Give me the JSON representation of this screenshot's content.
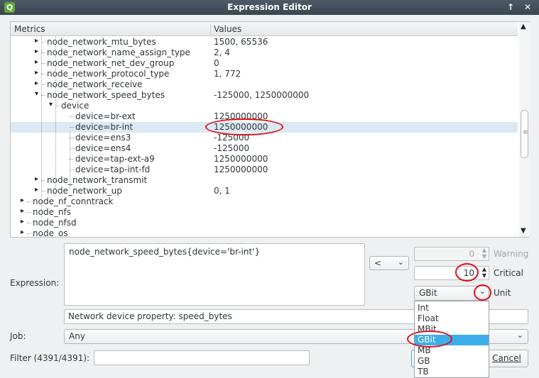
{
  "window": {
    "title": "Expression Editor",
    "icon_letter": "Q",
    "buttons": [
      "↑",
      "✕"
    ]
  },
  "tree": {
    "columns": [
      "Metrics",
      "Values"
    ],
    "rows": [
      {
        "label": "node_network_mtu_bytes",
        "value": "1500, 65536",
        "depth": 2,
        "arrow": "▸"
      },
      {
        "label": "node_network_name_assign_type",
        "value": "2, 4",
        "depth": 2,
        "arrow": "▸"
      },
      {
        "label": "node_network_net_dev_group",
        "value": "0",
        "depth": 2,
        "arrow": "▸"
      },
      {
        "label": "node_network_protocol_type",
        "value": "1, 772",
        "depth": 2,
        "arrow": "▸"
      },
      {
        "label": "node_network_receive",
        "value": "",
        "depth": 2,
        "arrow": "▸"
      },
      {
        "label": "node_network_speed_bytes",
        "value": "-125000, 1250000000",
        "depth": 2,
        "arrow": "▾"
      },
      {
        "label": "device",
        "value": "",
        "depth": 3,
        "arrow": "▾"
      },
      {
        "label": "device=br-ext",
        "value": "1250000000",
        "depth": 4,
        "arrow": ""
      },
      {
        "label": "device=br-int",
        "value": "1250000000",
        "depth": 4,
        "arrow": "",
        "selected": true
      },
      {
        "label": "device=ens3",
        "value": "-125000",
        "depth": 4,
        "arrow": ""
      },
      {
        "label": "device=ens4",
        "value": "-125000",
        "depth": 4,
        "arrow": ""
      },
      {
        "label": "device=tap-ext-a9",
        "value": "1250000000",
        "depth": 4,
        "arrow": ""
      },
      {
        "label": "device=tap-int-fd",
        "value": "1250000000",
        "depth": 4,
        "arrow": ""
      },
      {
        "label": "node_network_transmit",
        "value": "",
        "depth": 2,
        "arrow": "▸"
      },
      {
        "label": "node_network_up",
        "value": "0, 1",
        "depth": 2,
        "arrow": "▸"
      },
      {
        "label": "node_nf_conntrack",
        "value": "",
        "depth": 1,
        "arrow": "▸"
      },
      {
        "label": "node_nfs",
        "value": "",
        "depth": 1,
        "arrow": "▸"
      },
      {
        "label": "node_nfsd",
        "value": "",
        "depth": 1,
        "arrow": "▸"
      },
      {
        "label": "node_os",
        "value": "",
        "depth": 1,
        "arrow": "▸"
      }
    ]
  },
  "form": {
    "expression_label": "Expression:",
    "expression_value": "node_network_speed_bytes{device='br-int'}",
    "operator": "<",
    "warning_value": "0",
    "warning_label": "Warning",
    "critical_value": "10",
    "critical_label": "Critical",
    "unit_value": "GBit",
    "unit_label": "Unit",
    "description": "Network device property: speed_bytes",
    "job_label": "Job:",
    "job_value": "Any",
    "filter_label": "Filter (4391/4391):",
    "filter_value": "",
    "cancel_label": "Cancel"
  },
  "unit_options": [
    "Int",
    "Float",
    "MBit",
    "GBit",
    "MB",
    "GB",
    "TB"
  ],
  "unit_selected": "GBit",
  "colors": {
    "highlight": "#3daee9",
    "annotation_ring": "#e0101a",
    "titlebar": "#475560"
  }
}
